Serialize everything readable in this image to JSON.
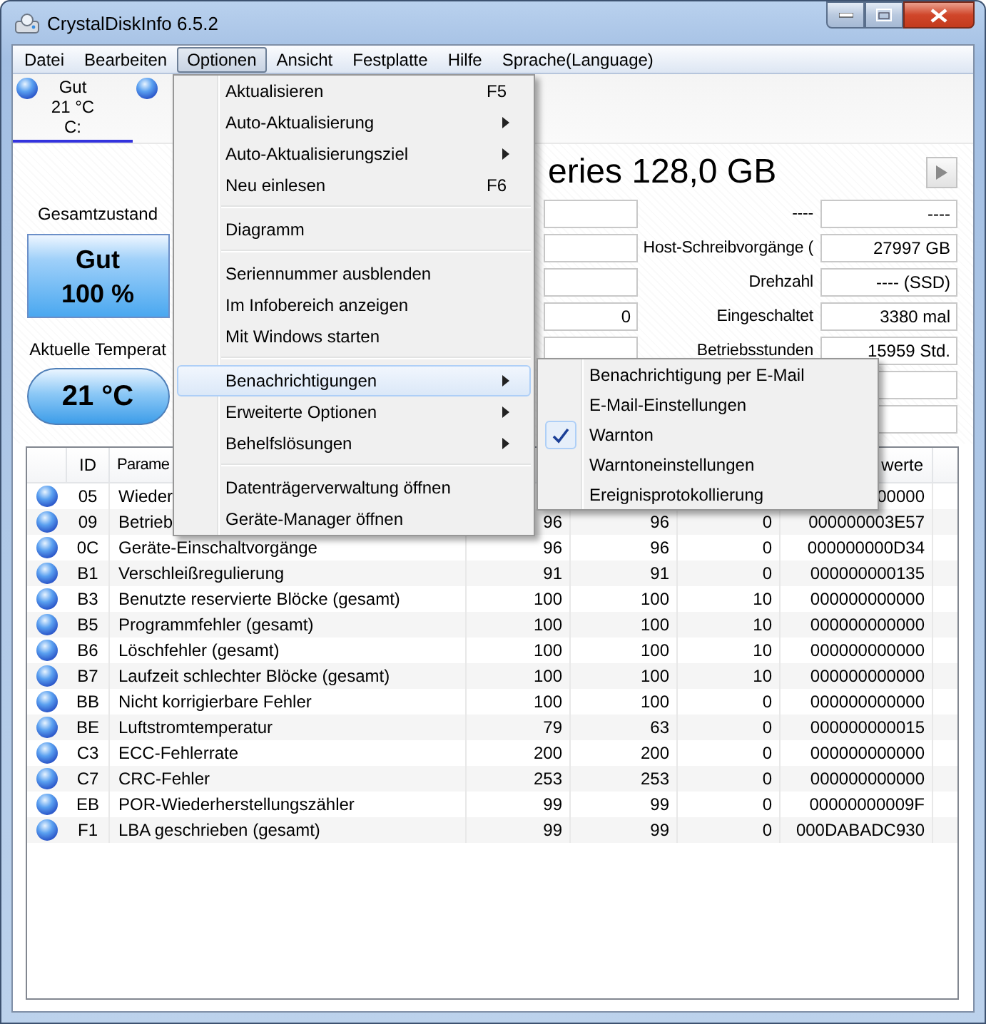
{
  "window": {
    "title": "CrystalDiskInfo 6.5.2"
  },
  "menu_bar": [
    {
      "label": "Datei",
      "selected": false
    },
    {
      "label": "Bearbeiten",
      "selected": false
    },
    {
      "label": "Optionen",
      "selected": true
    },
    {
      "label": "Ansicht",
      "selected": false
    },
    {
      "label": "Festplatte",
      "selected": false
    },
    {
      "label": "Hilfe",
      "selected": false
    },
    {
      "label": "Sprache(Language)",
      "selected": false
    }
  ],
  "disk_tabs": [
    {
      "status": "Gut",
      "temperature": "21 °C",
      "drive": "C:",
      "selected": true
    },
    {
      "selected": false
    }
  ],
  "model_title": "eries 128,0 GB",
  "health": {
    "label": "Gesamtzustand",
    "status": "Gut",
    "percent": "100 %"
  },
  "temperature": {
    "label": "Aktuelle Temperat",
    "value": "21 °C"
  },
  "info_left": [
    {
      "kind": "field"
    },
    {
      "kind": "field"
    },
    {
      "kind": "field"
    },
    {
      "kind": "field",
      "value": "0"
    },
    {
      "kind": "field"
    }
  ],
  "info_right": [
    {
      "kind": "field",
      "label": "----",
      "value": "----"
    },
    {
      "kind": "field",
      "label": "Host-Schreibvorgänge (",
      "value": "27997 GB"
    },
    {
      "kind": "field",
      "label": "Drehzahl",
      "value": "---- (SSD)"
    },
    {
      "kind": "field",
      "label": "Eingeschaltet",
      "value": "3380 mal"
    },
    {
      "kind": "field",
      "label": "Betriebsstunden",
      "value": "15959 Std."
    },
    {
      "kind": "field"
    },
    {
      "kind": "field"
    }
  ],
  "smart_table": {
    "columns": {
      "id": "ID",
      "attribute": "Parame",
      "raw": "werte"
    },
    "rows": [
      {
        "id": "05",
        "name": "Wieder",
        "raw": "00000"
      },
      {
        "id": "09",
        "name": "Betrieb",
        "current": "96",
        "worst": "96",
        "threshold": "0",
        "raw": "000000003E57"
      },
      {
        "id": "0C",
        "name": "Geräte-Einschaltvorgänge",
        "current": "96",
        "worst": "96",
        "threshold": "0",
        "raw": "000000000D34"
      },
      {
        "id": "B1",
        "name": "Verschleißregulierung",
        "current": "91",
        "worst": "91",
        "threshold": "0",
        "raw": "000000000135"
      },
      {
        "id": "B3",
        "name": "Benutzte reservierte Blöcke (gesamt)",
        "current": "100",
        "worst": "100",
        "threshold": "10",
        "raw": "000000000000"
      },
      {
        "id": "B5",
        "name": "Programmfehler (gesamt)",
        "current": "100",
        "worst": "100",
        "threshold": "10",
        "raw": "000000000000"
      },
      {
        "id": "B6",
        "name": "Löschfehler (gesamt)",
        "current": "100",
        "worst": "100",
        "threshold": "10",
        "raw": "000000000000"
      },
      {
        "id": "B7",
        "name": "Laufzeit schlechter Blöcke (gesamt)",
        "current": "100",
        "worst": "100",
        "threshold": "10",
        "raw": "000000000000"
      },
      {
        "id": "BB",
        "name": "Nicht korrigierbare Fehler",
        "current": "100",
        "worst": "100",
        "threshold": "0",
        "raw": "000000000000"
      },
      {
        "id": "BE",
        "name": "Luftstromtemperatur",
        "current": "79",
        "worst": "63",
        "threshold": "0",
        "raw": "000000000015"
      },
      {
        "id": "C3",
        "name": "ECC-Fehlerrate",
        "current": "200",
        "worst": "200",
        "threshold": "0",
        "raw": "000000000000"
      },
      {
        "id": "C7",
        "name": "CRC-Fehler",
        "current": "253",
        "worst": "253",
        "threshold": "0",
        "raw": "000000000000"
      },
      {
        "id": "EB",
        "name": "POR-Wiederherstellungszähler",
        "current": "99",
        "worst": "99",
        "threshold": "0",
        "raw": "00000000009F"
      },
      {
        "id": "F1",
        "name": "LBA geschrieben (gesamt)",
        "current": "99",
        "worst": "99",
        "threshold": "0",
        "raw": "000DABADC930"
      }
    ]
  },
  "options_menu": [
    {
      "kind": "item",
      "label": "Aktualisieren",
      "shortcut": "F5",
      "submenu": false,
      "selected": false
    },
    {
      "kind": "item",
      "label": "Auto-Aktualisierung",
      "submenu": true,
      "selected": false
    },
    {
      "kind": "item",
      "label": "Auto-Aktualisierungsziel",
      "submenu": true,
      "selected": false
    },
    {
      "kind": "item",
      "label": "Neu einlesen",
      "shortcut": "F6",
      "submenu": false,
      "selected": false
    },
    {
      "kind": "separator"
    },
    {
      "kind": "item",
      "label": "Diagramm",
      "submenu": false,
      "selected": false
    },
    {
      "kind": "separator"
    },
    {
      "kind": "item",
      "label": "Seriennummer ausblenden",
      "submenu": false,
      "selected": false
    },
    {
      "kind": "item",
      "label": "Im Infobereich anzeigen",
      "submenu": false,
      "selected": false
    },
    {
      "kind": "item",
      "label": "Mit Windows starten",
      "submenu": false,
      "selected": false
    },
    {
      "kind": "separator"
    },
    {
      "kind": "item",
      "label": "Benachrichtigungen",
      "submenu": true,
      "selected": true
    },
    {
      "kind": "item",
      "label": "Erweiterte Optionen",
      "submenu": true,
      "selected": false
    },
    {
      "kind": "item",
      "label": "Behelfslösungen",
      "submenu": true,
      "selected": false
    },
    {
      "kind": "separator"
    },
    {
      "kind": "item",
      "label": "Datenträgerverwaltung öffnen",
      "submenu": false,
      "selected": false
    },
    {
      "kind": "item",
      "label": "Geräte-Manager öffnen",
      "submenu": false,
      "selected": false
    }
  ],
  "notifications_submenu": [
    {
      "kind": "item",
      "label": "Benachrichtigung per E-Mail",
      "checked": false
    },
    {
      "kind": "item",
      "label": "E-Mail-Einstellungen",
      "checked": false
    },
    {
      "kind": "item",
      "label": "Warnton",
      "checked": true
    },
    {
      "kind": "item",
      "label": "Warntoneinstellungen",
      "checked": false
    },
    {
      "kind": "item",
      "label": "Ereignisprotokollierung",
      "checked": false
    }
  ]
}
